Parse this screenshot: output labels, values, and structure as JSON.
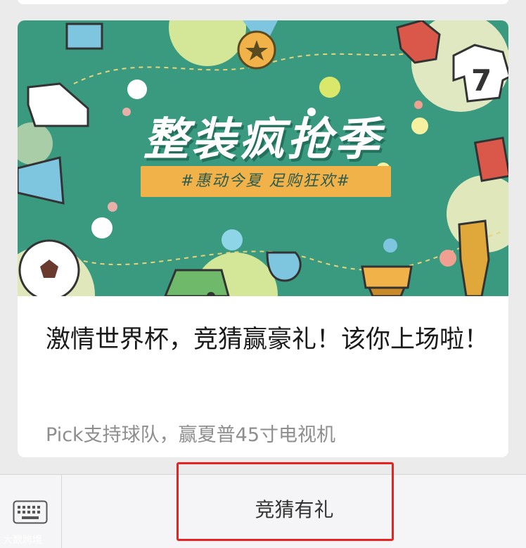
{
  "banner": {
    "title": "整装疯抢季",
    "tagline": "#惠动今夏 足购狂欢#",
    "jersey_number": "7"
  },
  "article": {
    "title": "激情世界杯，竞猜赢豪礼！该你上场啦！",
    "subtitle": "Pick支持球队，赢夏普45寸电视机"
  },
  "bottom_menu": {
    "keyboard_icon": "keyboard-icon",
    "item_label": "竞猜有礼"
  },
  "watermark": "大数跨境",
  "colors": {
    "banner_bg": "#3a9a80",
    "tag_bg": "#f2b24a",
    "highlight_border": "#e8231f"
  }
}
